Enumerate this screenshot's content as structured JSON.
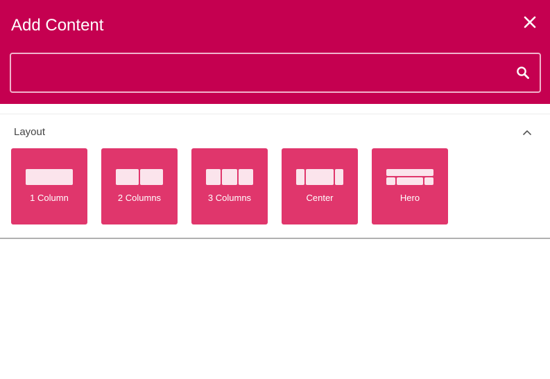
{
  "header": {
    "title": "Add Content",
    "close_icon": "close-icon",
    "background_color": "#c50050"
  },
  "search": {
    "value": "",
    "placeholder": "",
    "icon": "search-icon"
  },
  "layout_section": {
    "title": "Layout",
    "collapse_icon": "chevron-up-icon",
    "tile_color": "#e0366c",
    "tiles": [
      {
        "label": "1 Column",
        "icon": "one-column-layout-icon"
      },
      {
        "label": "2 Columns",
        "icon": "two-columns-layout-icon"
      },
      {
        "label": "3 Columns",
        "icon": "three-columns-layout-icon"
      },
      {
        "label": "Center",
        "icon": "center-layout-icon"
      },
      {
        "label": "Hero",
        "icon": "hero-layout-icon"
      }
    ]
  }
}
